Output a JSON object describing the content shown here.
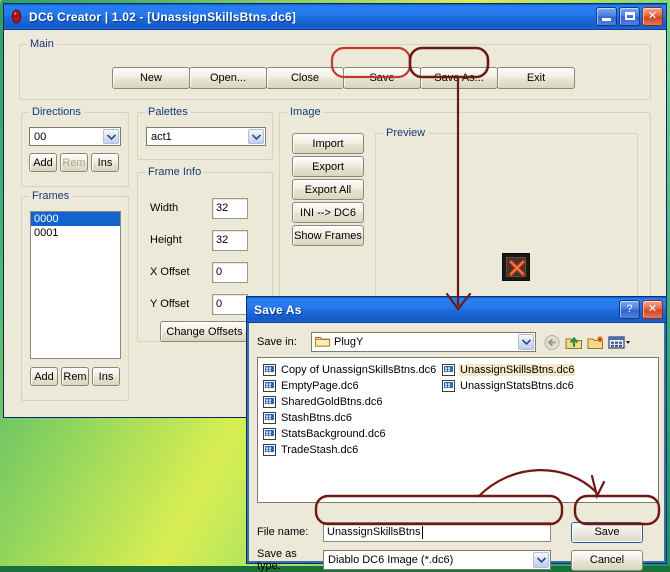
{
  "app": {
    "title": "DC6 Creator | 1.02 - [UnassignSkillsBtns.dc6]",
    "icon": "app-icon",
    "window_controls": {
      "minimize": "minimize-icon",
      "maximize": "maximize-icon",
      "close": "close-icon"
    }
  },
  "main_group": {
    "label": "Main",
    "buttons": [
      {
        "label": "New",
        "name": "new-button"
      },
      {
        "label": "Open...",
        "name": "open-button"
      },
      {
        "label": "Close",
        "name": "close-button"
      },
      {
        "label": "Save",
        "name": "save-button"
      },
      {
        "label": "Save As...",
        "name": "save-as-button"
      },
      {
        "label": "Exit",
        "name": "exit-button"
      }
    ]
  },
  "directions": {
    "label": "Directions",
    "combo_value": "00",
    "buttons": [
      {
        "label": "Add",
        "name": "directions-add-button",
        "disabled": false
      },
      {
        "label": "Rem",
        "name": "directions-rem-button",
        "disabled": true
      },
      {
        "label": "Ins",
        "name": "directions-ins-button",
        "disabled": false
      }
    ]
  },
  "frames": {
    "label": "Frames",
    "items": [
      "0000",
      "0001"
    ],
    "selected_index": 0,
    "buttons": [
      {
        "label": "Add",
        "name": "frames-add-button",
        "disabled": false
      },
      {
        "label": "Rem",
        "name": "frames-rem-button",
        "disabled": false
      },
      {
        "label": "Ins",
        "name": "frames-ins-button",
        "disabled": false
      }
    ]
  },
  "palettes": {
    "label": "Palettes",
    "combo_value": "act1"
  },
  "frame_info": {
    "label": "Frame Info",
    "fields": [
      {
        "label": "Width",
        "value": "32",
        "name": "width-field"
      },
      {
        "label": "Height",
        "value": "32",
        "name": "height-field"
      },
      {
        "label": "X Offset",
        "value": "0",
        "name": "x-offset-field"
      },
      {
        "label": "Y Offset",
        "value": "0",
        "name": "y-offset-field"
      }
    ],
    "change_offsets_label": "Change Offsets"
  },
  "image": {
    "label": "Image",
    "buttons": [
      {
        "label": "Import",
        "name": "import-button"
      },
      {
        "label": "Export",
        "name": "export-button"
      },
      {
        "label": "Export All",
        "name": "export-all-button"
      },
      {
        "label": "INI --> DC6",
        "name": "ini-to-dc6-button"
      },
      {
        "label": "Show Frames",
        "name": "show-frames-button"
      }
    ],
    "preview_label": "Preview",
    "preview_sprite": "red-x-button-sprite"
  },
  "save_dialog": {
    "title": "Save As",
    "help_glyph": "?",
    "help_name": "help-icon",
    "close_name": "close-icon",
    "save_in_label": "Save in:",
    "save_in_value": "PlugY",
    "toolbar": [
      {
        "name": "back-icon",
        "label": "Back"
      },
      {
        "name": "up-one-level-icon",
        "label": "Up One Level"
      },
      {
        "name": "new-folder-icon",
        "label": "Create New Folder"
      },
      {
        "name": "views-icon",
        "label": "Views"
      }
    ],
    "files_column_1": [
      "Copy of UnassignSkillsBtns.dc6",
      "EmptyPage.dc6",
      "SharedGoldBtns.dc6",
      "StashBtns.dc6",
      "StatsBackground.dc6",
      "TradeStash.dc6"
    ],
    "files_column_2": [
      "UnassignSkillsBtns.dc6",
      "UnassignStatsBtns.dc6"
    ],
    "selected_file": "UnassignSkillsBtns.dc6",
    "file_name_label": "File name:",
    "file_name_value": "UnassignSkillsBtns",
    "save_as_type_label": "Save as type:",
    "save_as_type_value": "Diablo DC6 Image (*.dc6)",
    "save_button_label": "Save",
    "cancel_button_label": "Cancel"
  },
  "annotations": {
    "highlight_color_light": "#c0392b",
    "highlight_color_dark": "#6e1a12",
    "callouts": [
      {
        "name": "save-button-highlight",
        "target": "Save"
      },
      {
        "name": "save-as-button-highlight",
        "target": "Save As..."
      },
      {
        "name": "save-as-to-dialog-arrow",
        "target": "Save As dialog"
      },
      {
        "name": "file-name-field-highlight",
        "target": "File name field"
      },
      {
        "name": "dialog-save-button-highlight",
        "target": "Save"
      },
      {
        "name": "file-name-to-save-arrow",
        "target": "Save"
      }
    ]
  }
}
